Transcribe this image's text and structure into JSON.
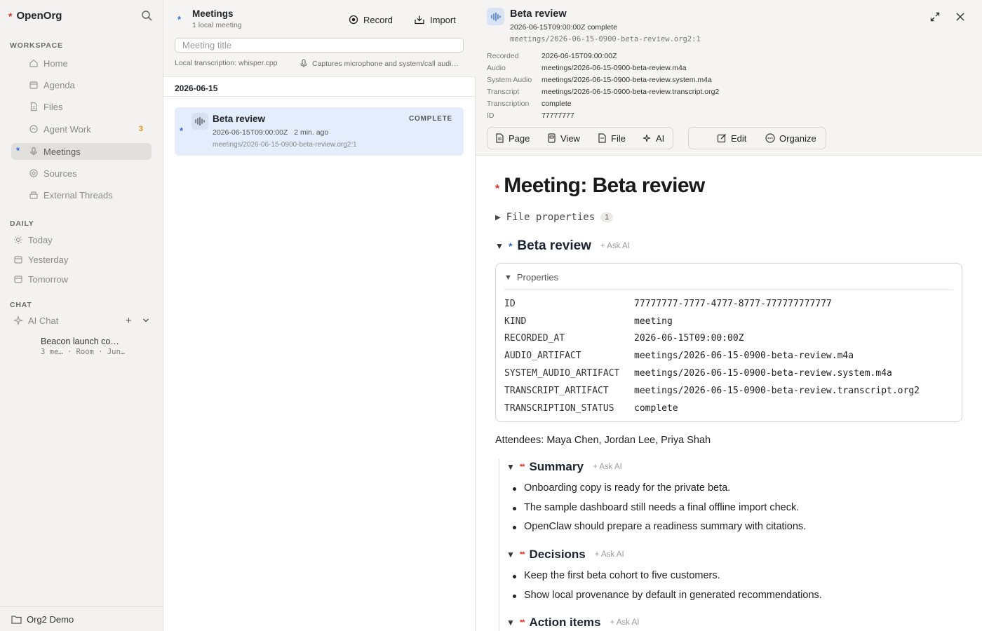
{
  "sidebar": {
    "brand": "OpenOrg",
    "sections": {
      "workspace": "WORKSPACE",
      "daily": "DAILY",
      "chat": "CHAT"
    },
    "workspace_items": [
      {
        "label": "Home",
        "icon": "home-icon"
      },
      {
        "label": "Agenda",
        "icon": "calendar-icon"
      },
      {
        "label": "Files",
        "icon": "file-icon"
      },
      {
        "label": "Agent Work",
        "icon": "agent-icon",
        "badge": "3"
      },
      {
        "label": "Meetings",
        "icon": "microphone-icon",
        "active": true,
        "marker": "*"
      },
      {
        "label": "Sources",
        "icon": "sources-icon"
      },
      {
        "label": "External Threads",
        "icon": "inbox-icon"
      }
    ],
    "daily_items": [
      {
        "label": "Today",
        "icon": "sun-icon"
      },
      {
        "label": "Yesterday",
        "icon": "calendar-icon"
      },
      {
        "label": "Tomorrow",
        "icon": "calendar-icon"
      }
    ],
    "chat": {
      "label": "AI Chat",
      "entry_title": "Beacon launch co…",
      "entry_meta": "3 me…  ·  Room  ·  Jun…"
    },
    "footer": "Org2 Demo"
  },
  "meetings_pane": {
    "title": "Meetings",
    "subtitle": "1 local meeting",
    "record_label": "Record",
    "import_label": "Import",
    "title_placeholder": "Meeting title",
    "transcription_info": "Local transcription: whisper.cpp",
    "capture_info": "Captures microphone and system/call audi…",
    "date_group": "2026-06-15",
    "meeting": {
      "title": "Beta review",
      "status": "COMPLETE",
      "recorded": "2026-06-15T09:00:00Z",
      "ago": "2 min. ago",
      "path": "meetings/2026-06-15-0900-beta-review.org2:1"
    }
  },
  "detail": {
    "title": "Beta review",
    "subtitle": "2026-06-15T09:00:00Z complete",
    "path": "meetings/2026-06-15-0900-beta-review.org2:1",
    "props": [
      {
        "k": "Recorded",
        "v": "2026-06-15T09:00:00Z"
      },
      {
        "k": "Audio",
        "v": "meetings/2026-06-15-0900-beta-review.m4a"
      },
      {
        "k": "System Audio",
        "v": "meetings/2026-06-15-0900-beta-review.system.m4a"
      },
      {
        "k": "Transcript",
        "v": "meetings/2026-06-15-0900-beta-review.transcript.org2"
      },
      {
        "k": "Transcription",
        "v": "complete"
      },
      {
        "k": "ID",
        "v": "77777777"
      }
    ],
    "toolbar": {
      "page": "Page",
      "view": "View",
      "file": "File",
      "ai": "AI",
      "edit": "Edit",
      "organize": "Organize"
    }
  },
  "document": {
    "h1": "Meeting: Beta review",
    "file_properties": "File properties",
    "file_properties_count": "1",
    "heading": "Beta review",
    "ask_ai": "+ Ask AI",
    "properties_label": "Properties",
    "properties": [
      {
        "k": "ID",
        "v": "77777777-7777-4777-8777-777777777777"
      },
      {
        "k": "KIND",
        "v": "meeting"
      },
      {
        "k": "RECORDED_AT",
        "v": "2026-06-15T09:00:00Z"
      },
      {
        "k": "AUDIO_ARTIFACT",
        "v": "meetings/2026-06-15-0900-beta-review.m4a"
      },
      {
        "k": "SYSTEM_AUDIO_ARTIFACT",
        "v": "meetings/2026-06-15-0900-beta-review.system.m4a"
      },
      {
        "k": "TRANSCRIPT_ARTIFACT",
        "v": "meetings/2026-06-15-0900-beta-review.transcript.org2"
      },
      {
        "k": "TRANSCRIPTION_STATUS",
        "v": "complete"
      }
    ],
    "attendees": "Attendees: Maya Chen, Jordan Lee, Priya Shah",
    "summary": {
      "title": "Summary",
      "items": [
        "Onboarding copy is ready for the private beta.",
        "The sample dashboard still needs a final offline import check.",
        "OpenClaw should prepare a readiness summary with citations."
      ]
    },
    "decisions": {
      "title": "Decisions",
      "items": [
        "Keep the first beta cohort to five customers.",
        "Show local provenance by default in generated recommendations."
      ]
    },
    "action_items": {
      "title": "Action items"
    }
  }
}
